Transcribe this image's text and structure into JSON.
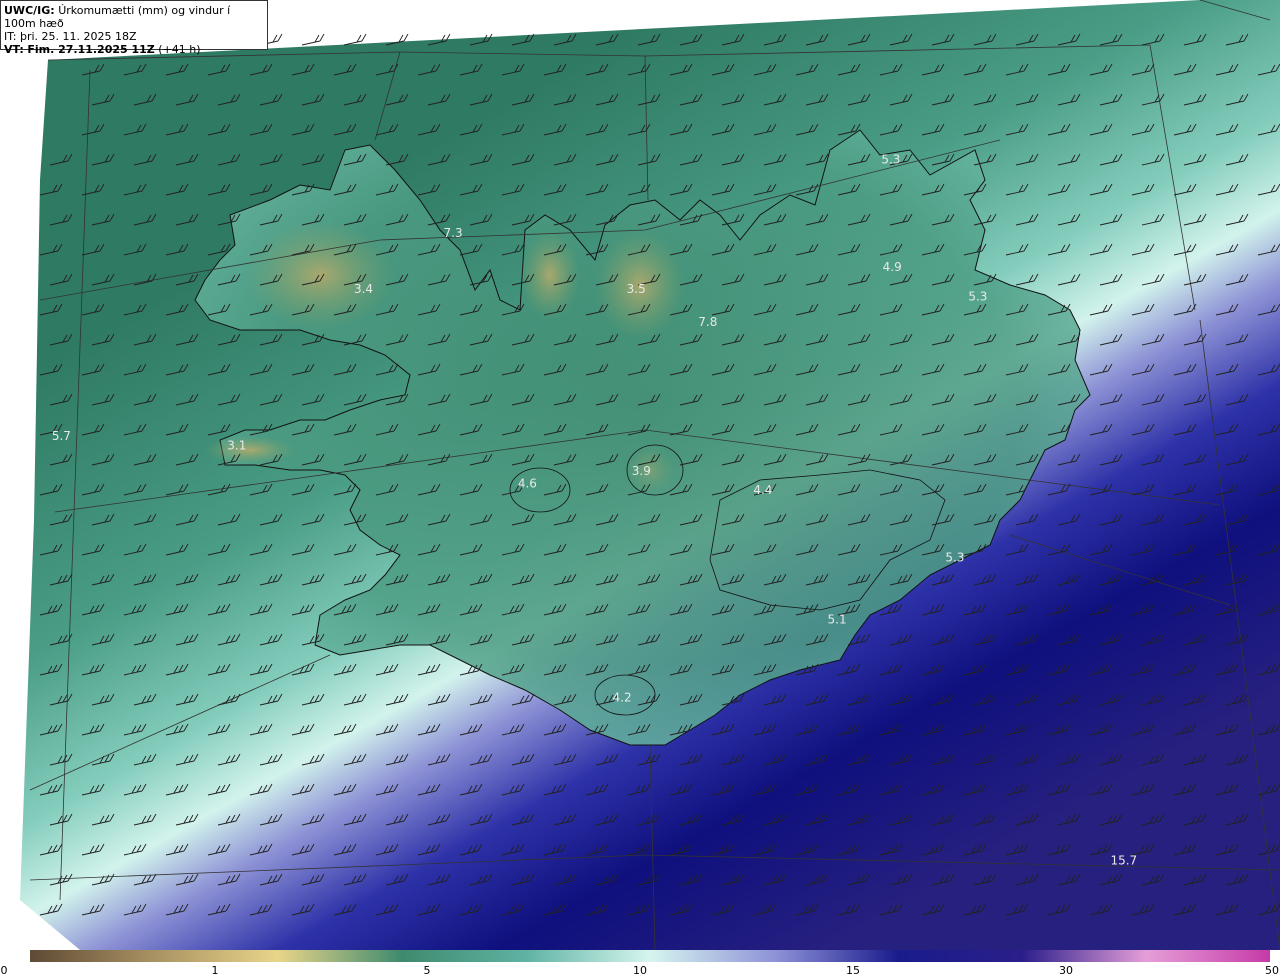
{
  "header": {
    "model": "UWC/IG:",
    "title": "Úrkomumætti (mm) og vindur í 100m hæð",
    "init_label": "IT:",
    "init_time": "þri. 25. 11. 2025 18Z",
    "valid_label": "VT:",
    "valid_time": "Fim. 27.11.2025 11Z",
    "lead": "(+41 h)"
  },
  "colors": {
    "land_outline": "#111111",
    "grid_line": "#333333",
    "barb": "#222222"
  },
  "labels": [
    {
      "text": "3.4",
      "name": "value-westfjords",
      "fx": 0.284,
      "fy": 0.304
    },
    {
      "text": "7.3",
      "name": "value-hornstrandir",
      "fx": 0.354,
      "fy": 0.245
    },
    {
      "text": "3.5",
      "name": "value-troll-peninsula",
      "fx": 0.497,
      "fy": 0.304
    },
    {
      "text": "7.8",
      "name": "value-eyjafjordur",
      "fx": 0.553,
      "fy": 0.339
    },
    {
      "text": "5.3",
      "name": "value-northeast",
      "fx": 0.696,
      "fy": 0.168
    },
    {
      "text": "4.9",
      "name": "value-northeast-inland",
      "fx": 0.697,
      "fy": 0.281
    },
    {
      "text": "5.3",
      "name": "value-east",
      "fx": 0.764,
      "fy": 0.312
    },
    {
      "text": "5.7",
      "name": "value-west-sea",
      "fx": 0.048,
      "fy": 0.459
    },
    {
      "text": "3.1",
      "name": "value-snaefellsnes",
      "fx": 0.185,
      "fy": 0.469
    },
    {
      "text": "4.6",
      "name": "value-west-highlands",
      "fx": 0.412,
      "fy": 0.509
    },
    {
      "text": "3.9",
      "name": "value-langjokull",
      "fx": 0.501,
      "fy": 0.496
    },
    {
      "text": "4.4",
      "name": "value-vatnajokull",
      "fx": 0.596,
      "fy": 0.516
    },
    {
      "text": "5.3",
      "name": "value-southeast",
      "fx": 0.746,
      "fy": 0.587
    },
    {
      "text": "5.1",
      "name": "value-south",
      "fx": 0.654,
      "fy": 0.652
    },
    {
      "text": "4.2",
      "name": "value-myrdalsjokull",
      "fx": 0.486,
      "fy": 0.734
    },
    {
      "text": "15.7",
      "name": "value-southeast-sea",
      "fx": 0.878,
      "fy": 0.906
    }
  ],
  "colorbar": {
    "ticks": [
      "0",
      "1",
      "5",
      "10",
      "15",
      "30",
      "50"
    ],
    "stops": [
      "#5e4a35",
      "#a99262",
      "#e8d589",
      "#3e8a6e",
      "#5fb3a3",
      "#d6f5ef",
      "#8f93d8",
      "#1a1c8c",
      "#2a1e8a",
      "#e59ed8",
      "#c63aa8"
    ]
  }
}
